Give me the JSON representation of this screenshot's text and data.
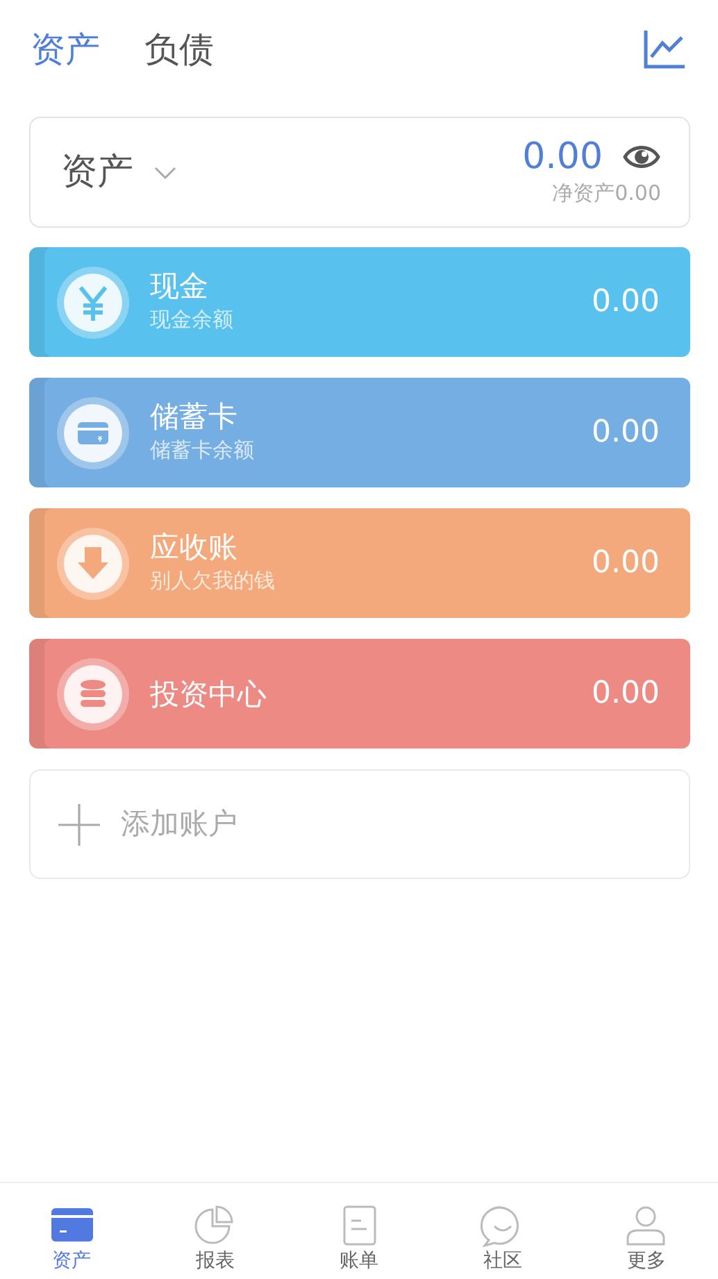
{
  "tabs": [
    {
      "label": "资产",
      "selected": true
    },
    {
      "label": "负债",
      "selected": false
    }
  ],
  "summary": {
    "title": "资产",
    "total": "0.00",
    "net": "净资产0.00"
  },
  "accounts": [
    {
      "kind": "cash",
      "name": "现金",
      "subtitle": "现金余额",
      "amount": "0.00",
      "color": "#59c1ee"
    },
    {
      "kind": "card",
      "name": "储蓄卡",
      "subtitle": "储蓄卡余额",
      "amount": "0.00",
      "color": "#75aee3"
    },
    {
      "kind": "receivable",
      "name": "应收账",
      "subtitle": "别人欠我的钱",
      "amount": "0.00",
      "color": "#f4a97c"
    },
    {
      "kind": "invest",
      "name": "投资中心",
      "amount": "0.00",
      "color": "#ee8a84"
    }
  ],
  "add_account": "添加账户",
  "bottom_nav": [
    {
      "kind": "assets",
      "label": "资产",
      "selected": true
    },
    {
      "kind": "report",
      "label": "报表",
      "selected": false
    },
    {
      "kind": "bill",
      "label": "账单",
      "selected": false
    },
    {
      "kind": "community",
      "label": "社区",
      "selected": false
    },
    {
      "kind": "more",
      "label": "更多",
      "selected": false
    }
  ]
}
